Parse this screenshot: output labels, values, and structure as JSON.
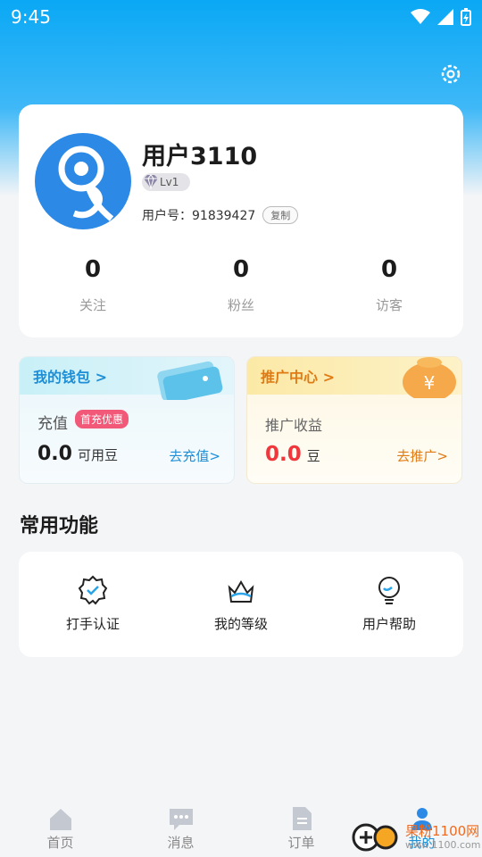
{
  "status_bar": {
    "time": "9:45"
  },
  "profile": {
    "username": "用户3110",
    "level": "Lv1",
    "uid_label": "用户号：",
    "uid": "91839427",
    "copy_label": "复制",
    "stats": [
      {
        "value": "0",
        "label": "关注"
      },
      {
        "value": "0",
        "label": "粉丝"
      },
      {
        "value": "0",
        "label": "访客"
      }
    ]
  },
  "wallet": {
    "title": "我的钱包 >",
    "label": "充值",
    "tag": "首充优惠",
    "amount": "0.0",
    "unit": "可用豆",
    "action": "去充值>"
  },
  "promo": {
    "title": "推广中心 >",
    "label": "推广收益",
    "amount": "0.0",
    "unit": "豆",
    "action": "去推广>"
  },
  "functions": {
    "title": "常用功能",
    "items": [
      {
        "label": "打手认证",
        "icon": "badge-check-icon"
      },
      {
        "label": "我的等级",
        "icon": "crown-icon"
      },
      {
        "label": "用户帮助",
        "icon": "lightbulb-icon"
      }
    ]
  },
  "tab_bar": {
    "items": [
      {
        "label": "首页",
        "icon": "home-icon"
      },
      {
        "label": "消息",
        "icon": "message-icon"
      },
      {
        "label": "订单",
        "icon": "order-icon"
      },
      {
        "label": "我的",
        "icon": "user-icon"
      }
    ],
    "active": "我的"
  },
  "watermark": {
    "text": "果粉1100网",
    "sub": "www.1100.com"
  },
  "colors": {
    "accent": "#1e8fd6",
    "brand_orange": "#e07b14",
    "amount_red": "#f0373c"
  }
}
